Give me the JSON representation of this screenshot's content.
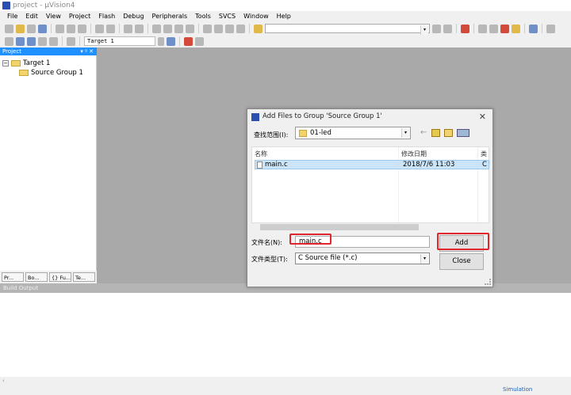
{
  "window": {
    "title": "project - µVision4"
  },
  "menu": [
    "File",
    "Edit",
    "View",
    "Project",
    "Flash",
    "Debug",
    "Peripherals",
    "Tools",
    "SVCS",
    "Window",
    "Help"
  ],
  "toolbar2": {
    "target": "Target 1"
  },
  "project_panel": {
    "title": "Project",
    "controls": "▾ ᵍ ✕",
    "tree": {
      "target": "Target 1",
      "group": "Source Group 1"
    },
    "tabs": [
      "Pr...",
      "Bo...",
      "{} Fu...",
      "Te..."
    ]
  },
  "build_output": {
    "title": "Build Output"
  },
  "status": {
    "mode": "Simulation"
  },
  "dialog": {
    "title": "Add Files to Group 'Source Group 1'",
    "look_in_label": "查找范围(I):",
    "look_in_value": "01-led",
    "columns": [
      "名称",
      "修改日期",
      "类"
    ],
    "files": [
      {
        "name": "main.c",
        "modified": "2018/7/6 11:03",
        "type": "C !"
      }
    ],
    "file_name_label": "文件名(N):",
    "file_name_value": "main.c",
    "file_type_label": "文件类型(T):",
    "file_type_value": "C Source file (*.c)",
    "add_label": "Add",
    "close_label": "Close"
  },
  "highlight_color": "#e0262c",
  "accent": "#1e90ff"
}
